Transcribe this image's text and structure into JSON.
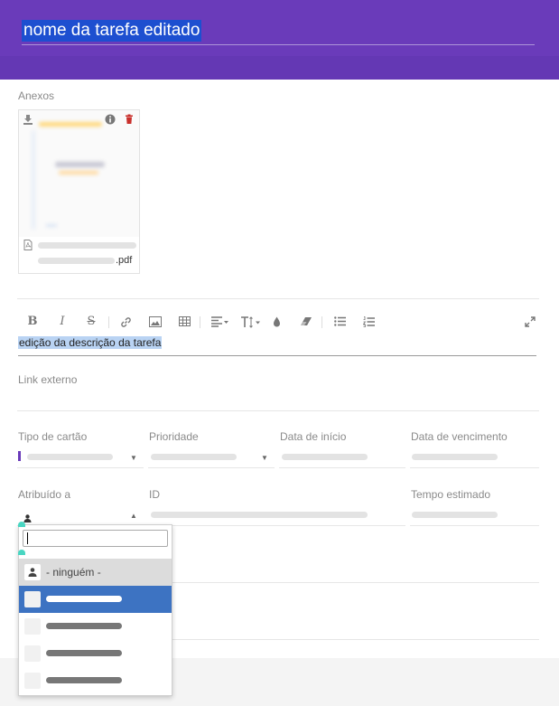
{
  "header": {
    "title": "nome da tarefa editado"
  },
  "attachments": {
    "label": "Anexos",
    "file_ext": ".pdf",
    "icons": {
      "download": "download-icon",
      "info": "info-icon",
      "delete": "trash-icon",
      "file": "pdf-file-icon"
    }
  },
  "toolbar": {
    "bold": "B",
    "italic": "I",
    "strike": "S",
    "link": "🔗",
    "image": "▣",
    "table": "▦",
    "align": "≡▾",
    "textsize": "T↕▾",
    "color": "●",
    "eraser": "◆",
    "ul": "☰",
    "ol": "⒈",
    "fullscreen": "⤢"
  },
  "description": {
    "text": "edição da descrição da tarefa"
  },
  "fields": {
    "external_link": "Link externo",
    "card_type": "Tipo de cartão",
    "priority": "Prioridade",
    "start_date": "Data de início",
    "due_date": "Data de vencimento",
    "assigned_to": "Atribuído a",
    "id": "ID",
    "estimated_time": "Tempo estimado"
  },
  "dropdown": {
    "search_value": "",
    "none_label": "- ninguém -",
    "selected_index": 1
  },
  "colors": {
    "header": "#6a3bba",
    "accent": "#6a3bba",
    "selected": "#3d73c2",
    "title_highlight": "#1d4fd0"
  }
}
